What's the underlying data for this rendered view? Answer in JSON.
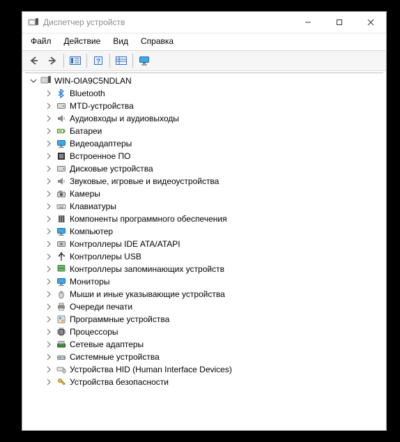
{
  "window": {
    "title": "Диспетчер устройств"
  },
  "menu": {
    "file": "Файл",
    "action": "Действие",
    "view": "Вид",
    "help": "Справка"
  },
  "tree": {
    "root": "WIN-OIA9C5NDLAN",
    "items": [
      {
        "icon": "bluetooth",
        "label": "Bluetooth"
      },
      {
        "icon": "disk",
        "label": "MTD-устройства"
      },
      {
        "icon": "audio",
        "label": "Аудиовходы и аудиовыходы"
      },
      {
        "icon": "battery",
        "label": "Батареи"
      },
      {
        "icon": "display",
        "label": "Видеоадаптеры"
      },
      {
        "icon": "firmware",
        "label": "Встроенное ПО"
      },
      {
        "icon": "disk",
        "label": "Дисковые устройства"
      },
      {
        "icon": "audio",
        "label": "Звуковые, игровые и видеоустройства"
      },
      {
        "icon": "camera",
        "label": "Камеры"
      },
      {
        "icon": "keyboard",
        "label": "Клавиатуры"
      },
      {
        "icon": "component",
        "label": "Компоненты программного обеспечения"
      },
      {
        "icon": "monitor",
        "label": "Компьютер"
      },
      {
        "icon": "ide",
        "label": "Контроллеры IDE ATA/ATAPI"
      },
      {
        "icon": "usb",
        "label": "Контроллеры USB"
      },
      {
        "icon": "storage",
        "label": "Контроллеры запоминающих устройств"
      },
      {
        "icon": "monitor",
        "label": "Мониторы"
      },
      {
        "icon": "mouse",
        "label": "Мыши и иные указывающие устройства"
      },
      {
        "icon": "printer",
        "label": "Очереди печати"
      },
      {
        "icon": "software",
        "label": "Программные устройства"
      },
      {
        "icon": "cpu",
        "label": "Процессоры"
      },
      {
        "icon": "network",
        "label": "Сетевые адаптеры"
      },
      {
        "icon": "system",
        "label": "Системные устройства"
      },
      {
        "icon": "hid",
        "label": "Устройства HID (Human Interface Devices)"
      },
      {
        "icon": "security",
        "label": "Устройства безопасности"
      }
    ]
  }
}
